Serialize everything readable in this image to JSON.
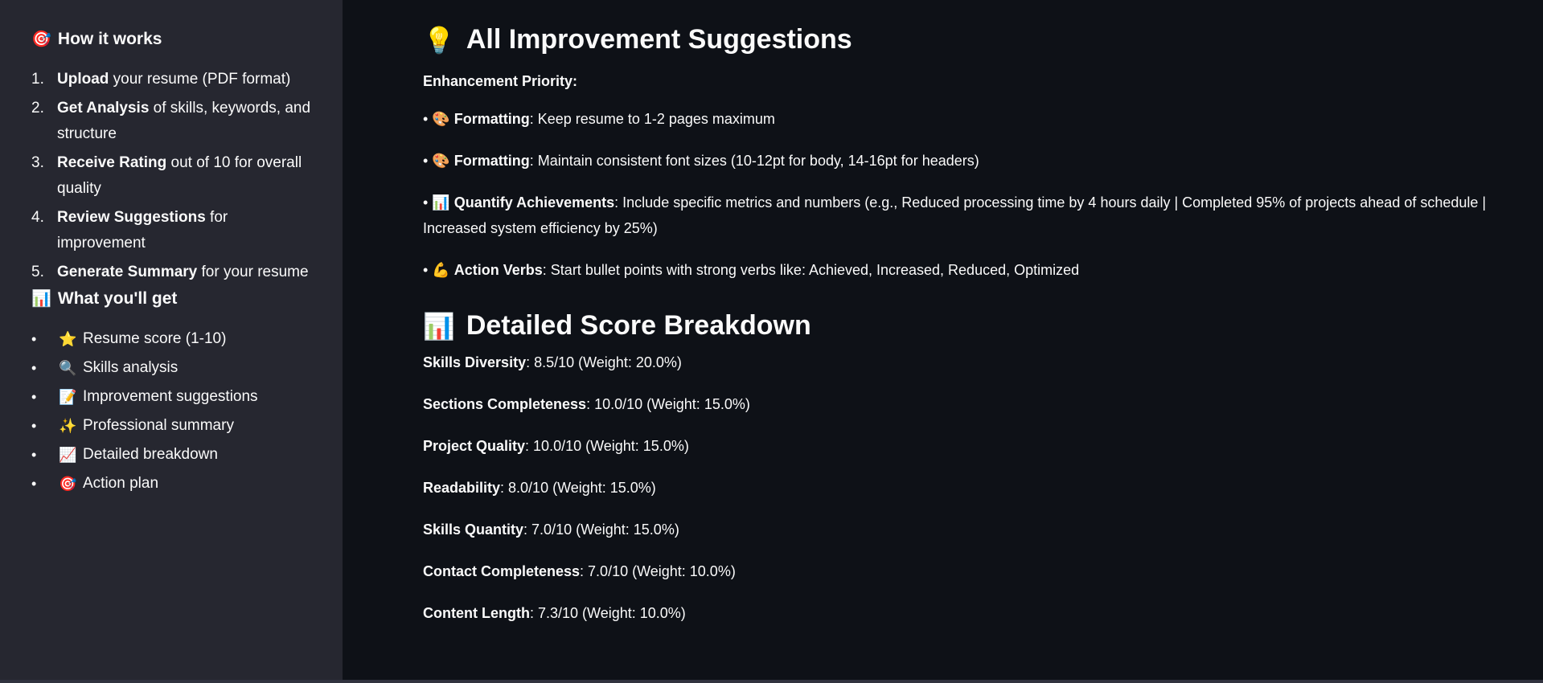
{
  "sidebar": {
    "how_title": "How it works",
    "how_icon": "🎯",
    "steps": [
      {
        "num": "1.",
        "bold": "Upload",
        "rest": " your resume (PDF format)"
      },
      {
        "num": "2.",
        "bold": "Get Analysis",
        "rest": " of skills, keywords, and structure"
      },
      {
        "num": "3.",
        "bold": "Receive Rating",
        "rest": " out of 10 for overall quality"
      },
      {
        "num": "4.",
        "bold": "Review Suggestions",
        "rest": " for improvement"
      },
      {
        "num": "5.",
        "bold": "Generate Summary",
        "rest": " for your resume"
      }
    ],
    "get_title": "What you'll get",
    "get_icon": "📊",
    "features": [
      {
        "icon": "⭐",
        "label": "Resume score (1-10)"
      },
      {
        "icon": "🔍",
        "label": "Skills analysis"
      },
      {
        "icon": "📝",
        "label": "Improvement suggestions"
      },
      {
        "icon": "✨",
        "label": "Professional summary"
      },
      {
        "icon": "📈",
        "label": "Detailed breakdown"
      },
      {
        "icon": "🎯",
        "label": "Action plan"
      }
    ]
  },
  "main": {
    "suggestions_title": "All Improvement Suggestions",
    "suggestions_icon": "💡",
    "priority_label": "Enhancement Priority:",
    "suggestions": [
      {
        "icon": "🎨",
        "bold": "Formatting",
        "rest": ": Keep resume to 1-2 pages maximum"
      },
      {
        "icon": "🎨",
        "bold": "Formatting",
        "rest": ": Maintain consistent font sizes (10-12pt for body, 14-16pt for headers)"
      },
      {
        "icon": "📊",
        "bold": "Quantify Achievements",
        "rest": ": Include specific metrics and numbers (e.g., Reduced processing time by 4 hours daily | Completed 95% of projects ahead of schedule | Increased system efficiency by 25%)"
      },
      {
        "icon": "💪",
        "bold": "Action Verbs",
        "rest": ": Start bullet points with strong verbs like: Achieved, Increased, Reduced, Optimized"
      }
    ],
    "breakdown_title": "Detailed Score Breakdown",
    "breakdown_icon": "📊",
    "scores": [
      {
        "bold": "Skills Diversity",
        "rest": ": 8.5/10 (Weight: 20.0%)"
      },
      {
        "bold": "Sections Completeness",
        "rest": ": 10.0/10 (Weight: 15.0%)"
      },
      {
        "bold": "Project Quality",
        "rest": ": 10.0/10 (Weight: 15.0%)"
      },
      {
        "bold": "Readability",
        "rest": ": 8.0/10 (Weight: 15.0%)"
      },
      {
        "bold": "Skills Quantity",
        "rest": ": 7.0/10 (Weight: 15.0%)"
      },
      {
        "bold": "Contact Completeness",
        "rest": ": 7.0/10 (Weight: 10.0%)"
      },
      {
        "bold": "Content Length",
        "rest": ": 7.3/10 (Weight: 10.0%)"
      }
    ]
  },
  "bullet_char": "•"
}
